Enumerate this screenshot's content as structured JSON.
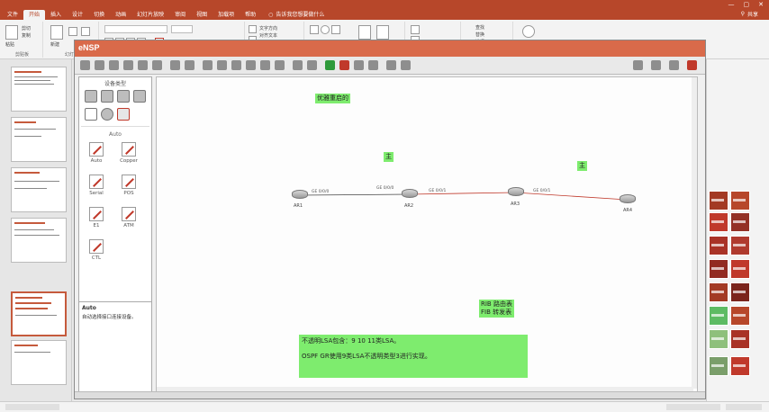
{
  "ppt": {
    "tabs": [
      "文件",
      "开始",
      "插入",
      "设计",
      "切换",
      "动画",
      "幻灯片放映",
      "审阅",
      "视图",
      "加载项",
      "帮助"
    ],
    "active_tab": "开始",
    "tell_me": "告诉我您想要做什么",
    "share": "共享"
  },
  "ribbon": {
    "clipboard_label": "剪贴板",
    "paste": "粘贴",
    "cut": "剪切",
    "copy": "复制",
    "new_slide": "新建",
    "slides_label": "幻灯片",
    "text_dir": "文字方向",
    "align_text": "对齐文本",
    "find": "查找",
    "replace": "替换",
    "select": "选择",
    "editing_label": "编辑"
  },
  "ensp": {
    "logo": "eNSP",
    "device_header": "设备类型",
    "cable_category": "Auto",
    "cables": [
      "Auto",
      "Copper",
      "Serial",
      "POS",
      "E1",
      "ATM",
      "CTL"
    ],
    "info_title": "Auto",
    "info_desc": "自动选择接口连接设备。"
  },
  "canvas": {
    "note_top": "优雅重启的",
    "area1": "主",
    "area2": "主",
    "routers": [
      "AR1",
      "AR2",
      "AR3",
      "AR4"
    ],
    "ports": [
      "GE 0/0/0",
      "GE 0/0/0",
      "GE 0/0/1",
      "GE 0/0/1"
    ],
    "rib_line": "RIB  路由表",
    "fib_line": "FIB  转发表",
    "lsa_line1": "不透明LSA包含：9  10  11类LSA。",
    "lsa_line2": "OSPF GR使用9类LSA不透明类型3进行实现。"
  },
  "colors": {
    "ppt_accent": "#b7472a",
    "note_green": "#7eec6e",
    "link_red": "#c0392b"
  }
}
